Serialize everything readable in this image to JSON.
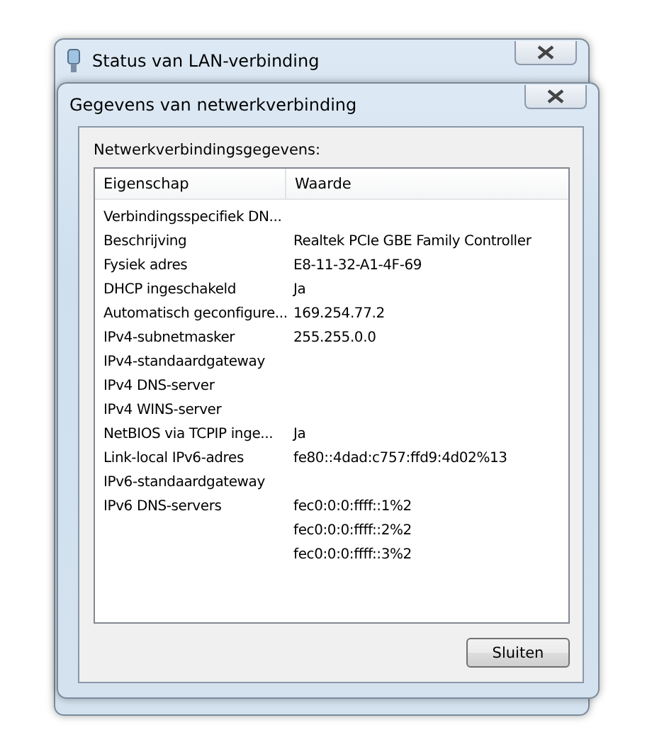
{
  "back_window": {
    "title": "Status van LAN-verbinding"
  },
  "window": {
    "title": "Gegevens van netwerkverbinding"
  },
  "section_label": "Netwerkverbindingsgegevens:",
  "table": {
    "columns": [
      "Eigenschap",
      "Waarde"
    ],
    "rows": [
      {
        "property": "Verbindingsspecifiek DN...",
        "values": []
      },
      {
        "property": "Beschrijving",
        "values": [
          "Realtek PCIe GBE Family Controller"
        ]
      },
      {
        "property": "Fysiek adres",
        "values": [
          "E8-11-32-A1-4F-69"
        ]
      },
      {
        "property": "DHCP ingeschakeld",
        "values": [
          "Ja"
        ]
      },
      {
        "property": "Automatisch geconfigure...",
        "values": [
          "169.254.77.2"
        ]
      },
      {
        "property": "IPv4-subnetmasker",
        "values": [
          "255.255.0.0"
        ]
      },
      {
        "property": "IPv4-standaardgateway",
        "values": []
      },
      {
        "property": "IPv4 DNS-server",
        "values": []
      },
      {
        "property": "IPv4 WINS-server",
        "values": []
      },
      {
        "property": "NetBIOS via TCPIP inge...",
        "values": [
          "Ja"
        ]
      },
      {
        "property": "Link-local IPv6-adres",
        "values": [
          "fe80::4dad:c757:ffd9:4d02%13"
        ]
      },
      {
        "property": "IPv6-standaardgateway",
        "values": []
      },
      {
        "property": "IPv6 DNS-servers",
        "values": [
          "fec0:0:0:ffff::1%2",
          "fec0:0:0:ffff::2%2",
          "fec0:0:0:ffff::3%2"
        ]
      }
    ]
  },
  "buttons": [
    "Sluiten"
  ]
}
